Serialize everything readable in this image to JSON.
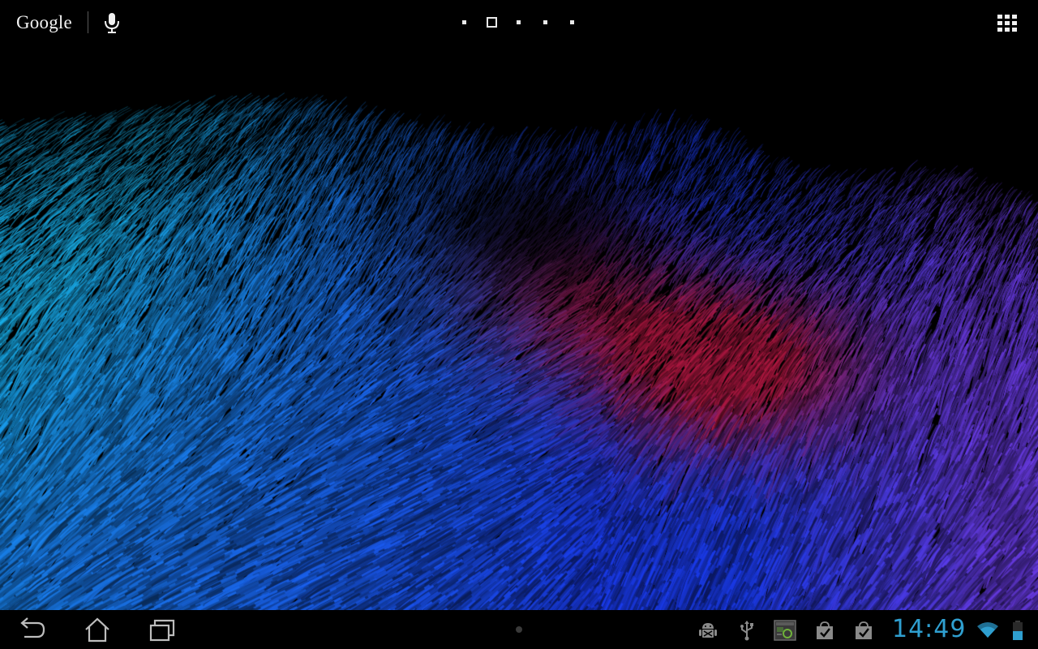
{
  "home_screen": {
    "search_bar": {
      "label": "Google",
      "icon": "microphone-icon"
    },
    "page_indicator": {
      "page_count": 5,
      "current_page": 2
    },
    "apps_button_icon": "apps-grid-icon",
    "wallpaper": "live-wallpaper-fur-field"
  },
  "system_bar": {
    "nav_buttons": [
      "back-icon",
      "home-icon",
      "recent-apps-icon"
    ],
    "notifications": [
      "android-debug-icon",
      "usb-icon",
      "screenshot-notification-icon",
      "store-update-icon",
      "store-update-icon"
    ],
    "clock": "14:49",
    "status_icons": [
      "wifi-icon",
      "battery-icon"
    ]
  },
  "colors": {
    "clock": "#2f9fd0",
    "fur_cyan": "#19b4f0",
    "fur_blue": "#1a3cf0",
    "fur_violet": "#6a3ce8",
    "fur_red": "#c81430",
    "bar_background": "#000000"
  }
}
